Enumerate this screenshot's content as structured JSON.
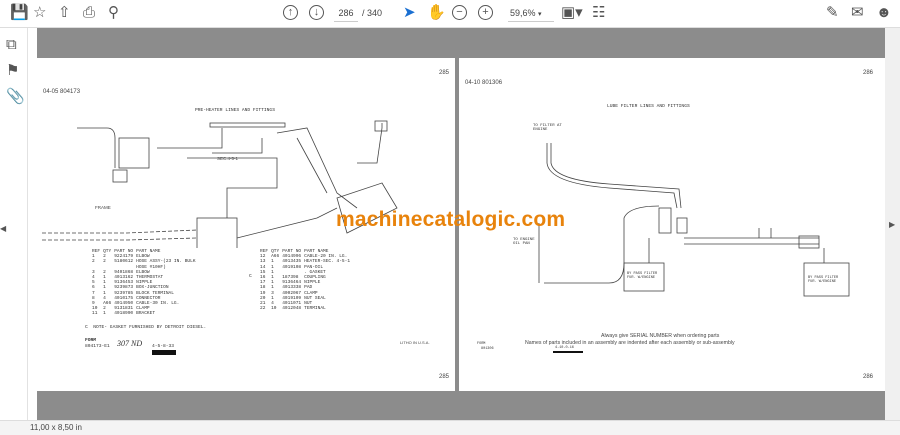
{
  "toolbar": {
    "page_current": "286",
    "page_total": "/ 340",
    "zoom": "59,6%"
  },
  "status": {
    "page_size": "11,00 x 8,50 in"
  },
  "watermark": "machinecatalogic.com",
  "left_page": {
    "header_code": "04-05  804173",
    "page_number_top": "285",
    "page_number_bottom": "285",
    "title": "PRE-HEATER LINES AND FITTINGS",
    "labels": {
      "frame": "FRAME",
      "sec": "SEC.4-5-1"
    },
    "columns": [
      "REF",
      "QTY",
      "PART NO",
      "PART NAME"
    ],
    "parts_a": [
      [
        "1",
        "2",
        "9224179",
        "ELBOW"
      ],
      [
        "2",
        "2",
        "5180612",
        "HOSE ASSY-(23 IN. BULK"
      ],
      [
        "",
        "",
        "",
        "HOSE #10HF)"
      ],
      [
        "3",
        "2",
        "9401868",
        "ELBOW"
      ],
      [
        "4",
        "1",
        "4013162",
        "THERMOSTAT"
      ],
      [
        "5",
        "1",
        "9136453",
        "NIPPLE"
      ],
      [
        "6",
        "1",
        "9239873",
        "BOX-JUNCTION"
      ],
      [
        "7",
        "1",
        "9239785",
        "BLOCK TERMINAL"
      ],
      [
        "8",
        "4",
        "4010175",
        "CONNECTOR"
      ],
      [
        "9",
        "A66",
        "4014950",
        "CABLE-30 IN. LG."
      ],
      [
        "10",
        "2",
        "9131831",
        "CLAMP"
      ],
      [
        "11",
        "1",
        "4018990",
        "BRACKET"
      ]
    ],
    "parts_b": [
      [
        "12",
        "A66",
        "4014996",
        "CABLE-20 IN. LG."
      ],
      [
        "13",
        "1",
        "4013435",
        "HEATER-SEC. 4-5-1"
      ],
      [
        "14",
        "1",
        "4019108",
        "PAN-OIL"
      ],
      [
        "15",
        "1",
        "",
        ". GASKET"
      ],
      [
        "16",
        "1",
        "187398",
        "COUPLING"
      ],
      [
        "17",
        "1",
        "9136464",
        "NIPPLE"
      ],
      [
        "18",
        "1",
        "4013338",
        "PAD"
      ],
      [
        "19",
        "3",
        "4002067",
        "CLAMP"
      ],
      [
        "20",
        "1",
        "4019109",
        "NUT SEAL"
      ],
      [
        "21",
        "4",
        "4011071",
        "NUT"
      ],
      [
        "22",
        "10",
        "4012048",
        "TERMINAL"
      ]
    ],
    "c_marker": "C",
    "note": "C  NOTE- GASKET FURNISHED BY DETROIT DIESEL.",
    "form_label": "FORM",
    "form_number": "804173-E1",
    "handwritten": "307 ND",
    "date_code": "4-5-8-33",
    "litho": "LITHO IN U.S.A."
  },
  "right_page": {
    "header_code": "04-10  801306",
    "page_number_top": "286",
    "page_number_bottom": "286",
    "title": "LUBE FILTER LINES AND FITTINGS",
    "labels": {
      "to_filter": "TO FILTER AT ENGINE",
      "to_engine": "TO ENGINE OIL PAN",
      "bypass1": "BY PASS FILTER FUR. W/ENGINE",
      "bypass2": "BY PASS FILTER FUR. W/ENGINE"
    },
    "notice_1": "Always give SERIAL NUMBER when ordering parts",
    "notice_2": "Names of parts included in an assembly are indented after each assembly or sub-assembly",
    "form_label": "FORM",
    "form_number": "801306",
    "date_code": "4-10-0-16"
  }
}
